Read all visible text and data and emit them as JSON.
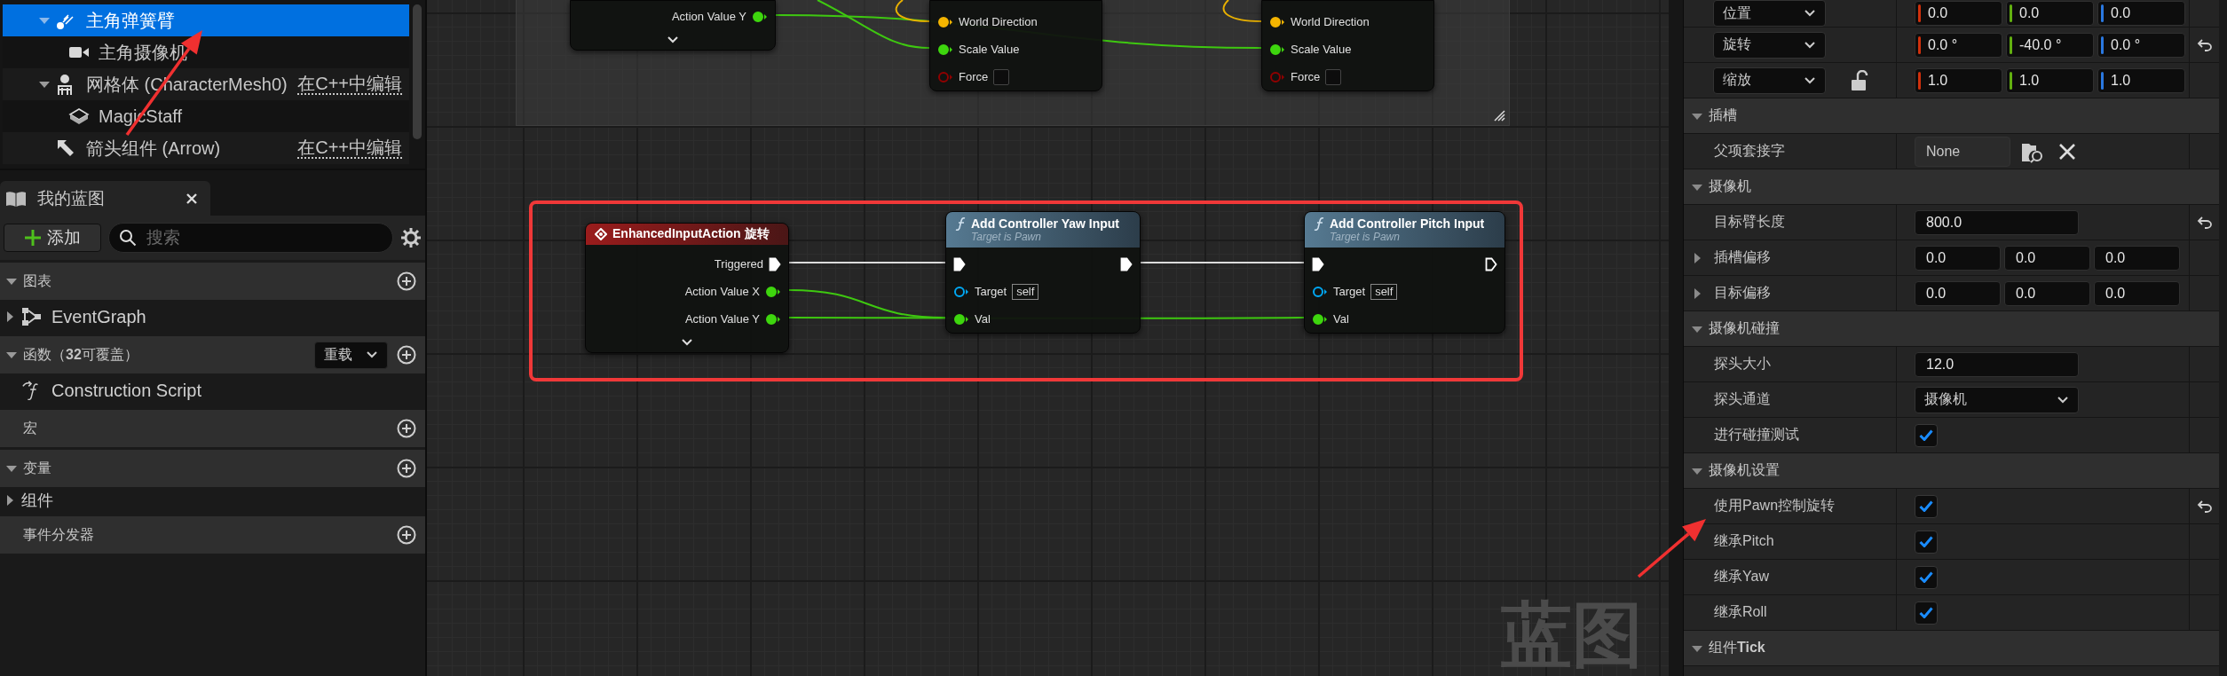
{
  "components_tree": [
    {
      "label": "主角弹簧臂",
      "kind": "spring-arm",
      "selected": true,
      "expanded": true,
      "children": [
        {
          "label": "主角摄像机",
          "kind": "camera",
          "selected": false
        }
      ]
    },
    {
      "label": "网格体 (CharacterMesh0)",
      "kind": "skeletal-mesh",
      "selected": false,
      "expanded": true,
      "link": "在C++中编辑",
      "children": [
        {
          "label": "MagicStaff",
          "kind": "static-mesh",
          "selected": false
        }
      ]
    },
    {
      "label": "箭头组件 (Arrow)",
      "kind": "arrow",
      "selected": false,
      "link": "在C++中编辑"
    }
  ],
  "my_blueprint": {
    "tab": "我的蓝图",
    "add_button": "添加",
    "search": {
      "placeholder": "搜索"
    },
    "sections": [
      {
        "title": "图表",
        "expanded": true,
        "add": true,
        "items": [
          {
            "label": "EventGraph",
            "kind": "graph",
            "expanded": false
          }
        ]
      },
      {
        "title": "函数（**32**可覆盖）",
        "expanded": true,
        "menu": "重载",
        "add": true,
        "items": [
          {
            "label": "Construction Script",
            "kind": "function"
          }
        ]
      },
      {
        "title": "宏",
        "add": true
      },
      {
        "title": "变量",
        "expanded": true,
        "add": true,
        "items": [
          {
            "label": "组件",
            "kind": "category",
            "expanded": false
          }
        ]
      },
      {
        "title": "事件分发器",
        "add": true
      }
    ]
  },
  "graph": {
    "label": "蓝图",
    "nodes": [
      {
        "kind": "fragment",
        "advanced": true,
        "rows": [
          {
            "out": {
              "name": "Action Value Y",
              "kind": "float",
              "connected": true
            }
          }
        ]
      },
      {
        "kind": "fragment",
        "rows": [
          {
            "in": {
              "name": "World Direction",
              "kind": "vector",
              "connected": true
            }
          },
          {
            "in": {
              "name": "Scale Value",
              "kind": "float",
              "connected": true
            }
          },
          {
            "in": {
              "name": "Force",
              "kind": "bool",
              "connected": false,
              "checked": false
            }
          }
        ]
      },
      {
        "kind": "fragment",
        "rows": [
          {
            "in": {
              "name": "World Direction",
              "kind": "vector",
              "connected": true
            }
          },
          {
            "in": {
              "name": "Scale Value",
              "kind": "float",
              "connected": true
            }
          },
          {
            "in": {
              "name": "Force",
              "kind": "bool",
              "connected": false,
              "checked": false
            }
          }
        ]
      },
      {
        "kind": "event",
        "title": "EnhancedInputAction 旋转",
        "advanced": true,
        "rows": [
          {
            "out": {
              "name": "Triggered",
              "kind": "exec",
              "connected": true
            }
          },
          {
            "out": {
              "name": "Action Value X",
              "kind": "float",
              "connected": true
            }
          },
          {
            "out": {
              "name": "Action Value Y",
              "kind": "float",
              "connected": true
            }
          }
        ]
      },
      {
        "kind": "function",
        "title": "Add Controller Yaw Input",
        "subtitle": "Target is Pawn",
        "rows": [
          {
            "in": {
              "kind": "exec",
              "connected": true
            },
            "out": {
              "kind": "exec",
              "connected": true
            }
          },
          {
            "in": {
              "name": "Target",
              "kind": "object",
              "connected": false,
              "default": "self"
            }
          },
          {
            "in": {
              "name": "Val",
              "kind": "float",
              "connected": true
            }
          }
        ]
      },
      {
        "kind": "function",
        "title": "Add Controller Pitch Input",
        "subtitle": "Target is Pawn",
        "rows": [
          {
            "in": {
              "kind": "exec",
              "connected": true
            },
            "out": {
              "kind": "exec",
              "connected": false
            }
          },
          {
            "in": {
              "name": "Target",
              "kind": "object",
              "connected": false,
              "default": "self"
            }
          },
          {
            "in": {
              "name": "Val",
              "kind": "float",
              "connected": true
            }
          }
        ]
      }
    ]
  },
  "details": {
    "transform": [
      {
        "label": "位置",
        "modified": false,
        "values": [
          {
            "value": "0.0",
            "color": "#d0300c"
          },
          {
            "value": "0.0",
            "color": "#62b010"
          },
          {
            "value": "0.0",
            "color": "#2a78e0"
          }
        ]
      },
      {
        "label": "旋转",
        "modified": true,
        "values": [
          {
            "value": "0.0 °",
            "color": "#d0300c"
          },
          {
            "value": "-40.0 °",
            "color": "#62b010"
          },
          {
            "value": "0.0 °",
            "color": "#2a78e0"
          }
        ]
      },
      {
        "label": "缩放",
        "modified": false,
        "locked": false,
        "values": [
          {
            "value": "1.0",
            "color": "#d0300c"
          },
          {
            "value": "1.0",
            "color": "#62b010"
          },
          {
            "value": "1.0",
            "color": "#2a78e0"
          }
        ]
      }
    ],
    "sections": [
      {
        "title": "插槽",
        "expanded": true,
        "rows": [
          {
            "kind": "asset",
            "label": "父项套接字",
            "value": "None",
            "modified": false
          }
        ]
      },
      {
        "title": "摄像机",
        "expanded": true,
        "rows": [
          {
            "kind": "number",
            "label": "目标臂长度",
            "value": "800.0",
            "modified": true
          },
          {
            "kind": "vector",
            "label": "插槽偏移",
            "expanded": false,
            "values": [
              "0.0",
              "0.0",
              "0.0"
            ],
            "modified": false
          },
          {
            "kind": "vector",
            "label": "目标偏移",
            "expanded": false,
            "values": [
              "0.0",
              "0.0",
              "0.0"
            ],
            "modified": false
          }
        ]
      },
      {
        "title": "摄像机碰撞",
        "expanded": true,
        "rows": [
          {
            "kind": "number",
            "label": "探头大小",
            "value": "12.0",
            "modified": false
          },
          {
            "kind": "dropdown",
            "label": "探头通道",
            "value": "摄像机",
            "modified": false
          },
          {
            "kind": "checkbox",
            "label": "进行碰撞测试",
            "checked": true,
            "modified": false
          }
        ]
      },
      {
        "title": "摄像机设置",
        "expanded": true,
        "rows": [
          {
            "kind": "checkbox",
            "label": "使用Pawn控制旋转",
            "checked": true,
            "modified": true
          },
          {
            "kind": "checkbox",
            "label": "继承Pitch",
            "checked": true,
            "modified": false
          },
          {
            "kind": "checkbox",
            "label": "继承Yaw",
            "checked": true,
            "modified": false
          },
          {
            "kind": "checkbox",
            "label": "继承Roll",
            "checked": true,
            "modified": false
          }
        ]
      },
      {
        "title": "组件**Tick**",
        "expanded": true
      }
    ]
  },
  "annotations": [
    {
      "kind": "arrow"
    },
    {
      "kind": "arrow"
    },
    {
      "kind": "frame"
    }
  ]
}
